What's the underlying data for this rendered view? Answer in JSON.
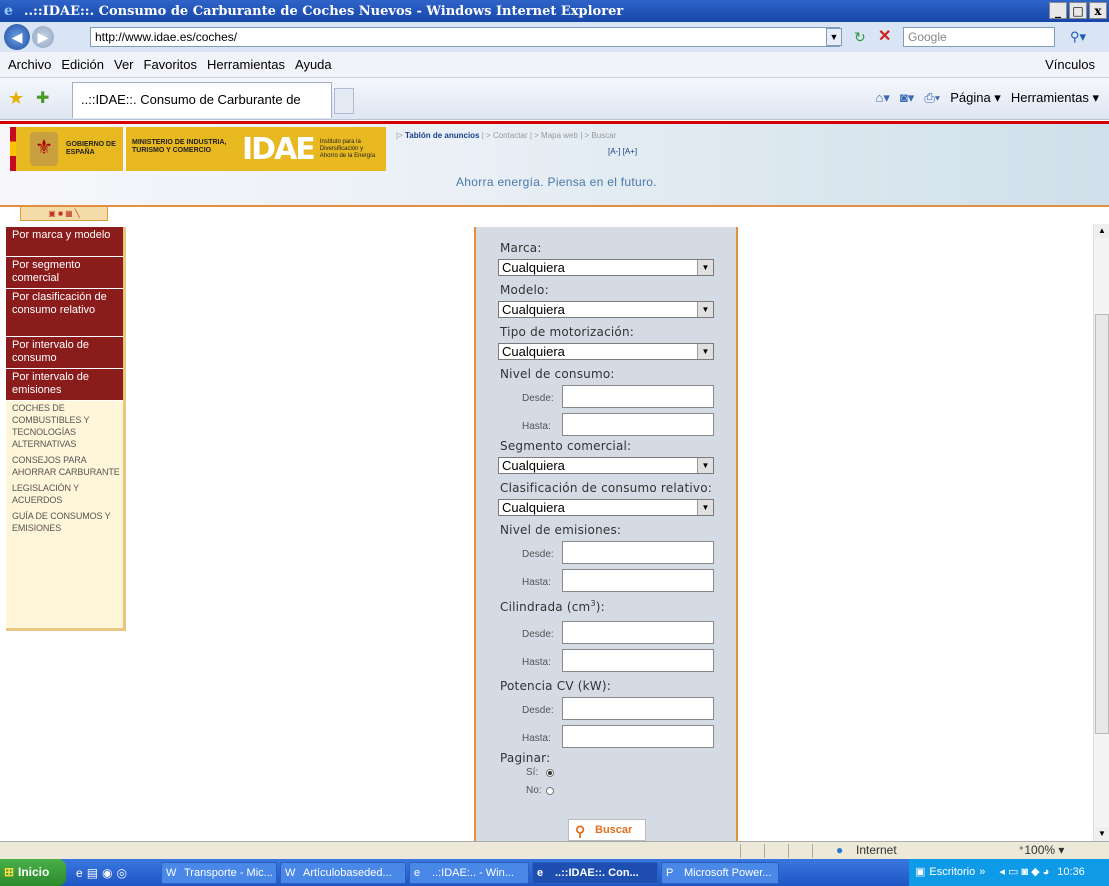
{
  "window": {
    "title": "..::IDAE::. Consumo de Carburante de Coches Nuevos - Windows Internet Explorer",
    "min": "_",
    "max": "□",
    "close": "x"
  },
  "address": {
    "url": "http://www.idae.es/coches/",
    "search_placeholder": "Google"
  },
  "menu": {
    "items": [
      "Archivo",
      "Edición",
      "Ver",
      "Favoritos",
      "Herramientas",
      "Ayuda"
    ],
    "links_label": "Vínculos"
  },
  "tabs": {
    "active_title": "..::IDAE::. Consumo de Carburante de Co..."
  },
  "commandbar": {
    "page": "Página",
    "tools": "Herramientas"
  },
  "header": {
    "gobierno": "GOBIERNO DE ESPAÑA",
    "ministerio": "MINISTERIO DE INDUSTRIA, TURISMO Y COMERCIO",
    "idae_logo": "IDAE",
    "idae_tagline": "Instituto para la Diversificación y Ahorro de la Energía",
    "links": {
      "tablon": "Tablón de anuncios",
      "contactar": "Contactar",
      "mapa": "Mapa web",
      "buscar": "Buscar"
    },
    "font_sizes": "[A-] [A+]",
    "motto": "Ahorra energía. Piensa en el futuro."
  },
  "sidebar": {
    "active": [
      "Por marca y modelo",
      "Por segmento comercial",
      "Por clasificación de consumo relativo",
      "Por intervalo de consumo",
      "Por intervalo de emisiones"
    ],
    "sections": [
      "Coches de combustibles y tecnologías alternativas",
      "Consejos para ahorrar carburante",
      "Legislación y acuerdos",
      "Guía de consumos y emisiones"
    ]
  },
  "form": {
    "marca_label": "Marca:",
    "marca_value": "Cualquiera",
    "modelo_label": "Modelo:",
    "modelo_value": "Cualquiera",
    "motor_label": "Tipo de motorización:",
    "motor_value": "Cualquiera",
    "consumo_label": "Nivel de consumo:",
    "segmento_label": "Segmento comercial:",
    "segmento_value": "Cualquiera",
    "clasif_label": "Clasificación de consumo relativo:",
    "clasif_value": "Cualquiera",
    "emisiones_label": "Nivel de emisiones:",
    "cilindrada_label": "Cilindrada (cm",
    "cilindrada_sup": "3",
    "cilindrada_end": "):",
    "potencia_label": "Potencia CV (kW):",
    "desde": "Desde:",
    "hasta": "Hasta:",
    "paginar_label": "Paginar:",
    "si": "Sí:",
    "no": "No:",
    "paginar_selected": "Sí",
    "submit": "Buscar"
  },
  "status": {
    "zone": "Internet",
    "zoom": "100%"
  },
  "taskbar": {
    "start": "Inicio",
    "tasks": [
      "Transporte - Mic...",
      "Artículobaseded...",
      "..:IDAE:.. - Win...",
      "..::IDAE::. Con...",
      "Microsoft Power..."
    ],
    "escritorio": "Escritorio",
    "time": "10:36"
  }
}
